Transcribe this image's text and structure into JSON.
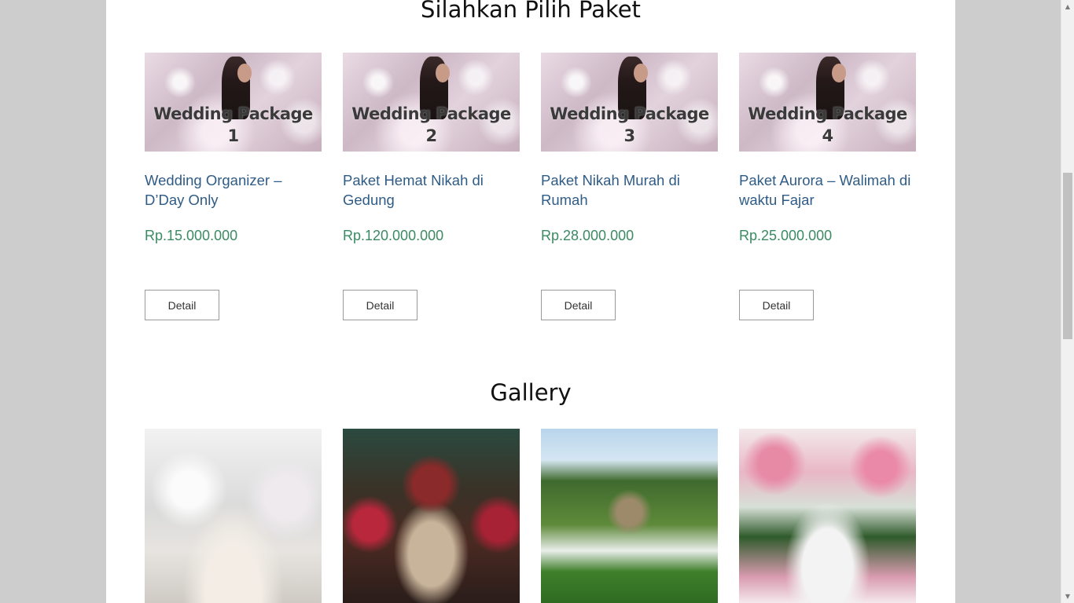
{
  "paket_section": {
    "title": "Silahkan Pilih Paket",
    "cards": [
      {
        "thumb_text": "Wedding Package 1",
        "title": "Wedding Organizer – D’Day Only",
        "price": "Rp.15.000.000",
        "button": "Detail"
      },
      {
        "thumb_text": "Wedding Package 2",
        "title": "Paket Hemat Nikah di Gedung",
        "price": "Rp.120.000.000",
        "button": "Detail"
      },
      {
        "thumb_text": "Wedding Package 3",
        "title": "Paket Nikah Murah di Rumah",
        "price": "Rp.28.000.000",
        "button": "Detail"
      },
      {
        "thumb_text": "Wedding Package 4",
        "title": "Paket Aurora – Walimah di waktu Fajar",
        "price": "Rp.25.000.000",
        "button": "Detail"
      }
    ]
  },
  "gallery_section": {
    "title": "Gallery"
  },
  "scrollbar": {
    "up_icon": "chevron-up-icon",
    "down_icon": "chevron-down-icon"
  }
}
